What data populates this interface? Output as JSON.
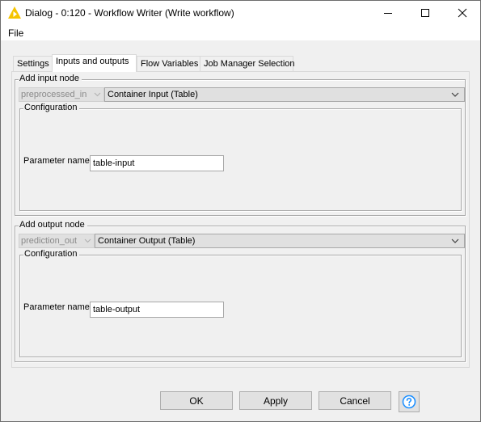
{
  "window": {
    "title": "Dialog - 0:120 - Workflow Writer (Write workflow)",
    "icon": "knime-warning-triangle-icon",
    "accent_color": "#f5c400"
  },
  "menubar": {
    "items": [
      {
        "label": "File"
      }
    ]
  },
  "tabs": [
    {
      "label": "Settings",
      "active": false
    },
    {
      "label": "Inputs and outputs",
      "active": true
    },
    {
      "label": "Flow Variables",
      "active": false
    },
    {
      "label": "Job Manager Selection",
      "active": false
    }
  ],
  "input_group": {
    "legend": "Add input node",
    "port_combo": {
      "value": "preprocessed_in",
      "disabled": true
    },
    "type_combo": {
      "value": "Container Input (Table)"
    },
    "config": {
      "legend": "Configuration",
      "param_label": "Parameter name",
      "param_value": "table-input"
    }
  },
  "output_group": {
    "legend": "Add output node",
    "port_combo": {
      "value": "prediction_out",
      "disabled": true
    },
    "type_combo": {
      "value": "Container Output (Table)"
    },
    "config": {
      "legend": "Configuration",
      "param_label": "Parameter name",
      "param_value": "table-output"
    }
  },
  "buttons": {
    "ok": "OK",
    "apply": "Apply",
    "cancel": "Cancel",
    "help_icon": "question-circle-icon",
    "help_color": "#1e90ff"
  }
}
